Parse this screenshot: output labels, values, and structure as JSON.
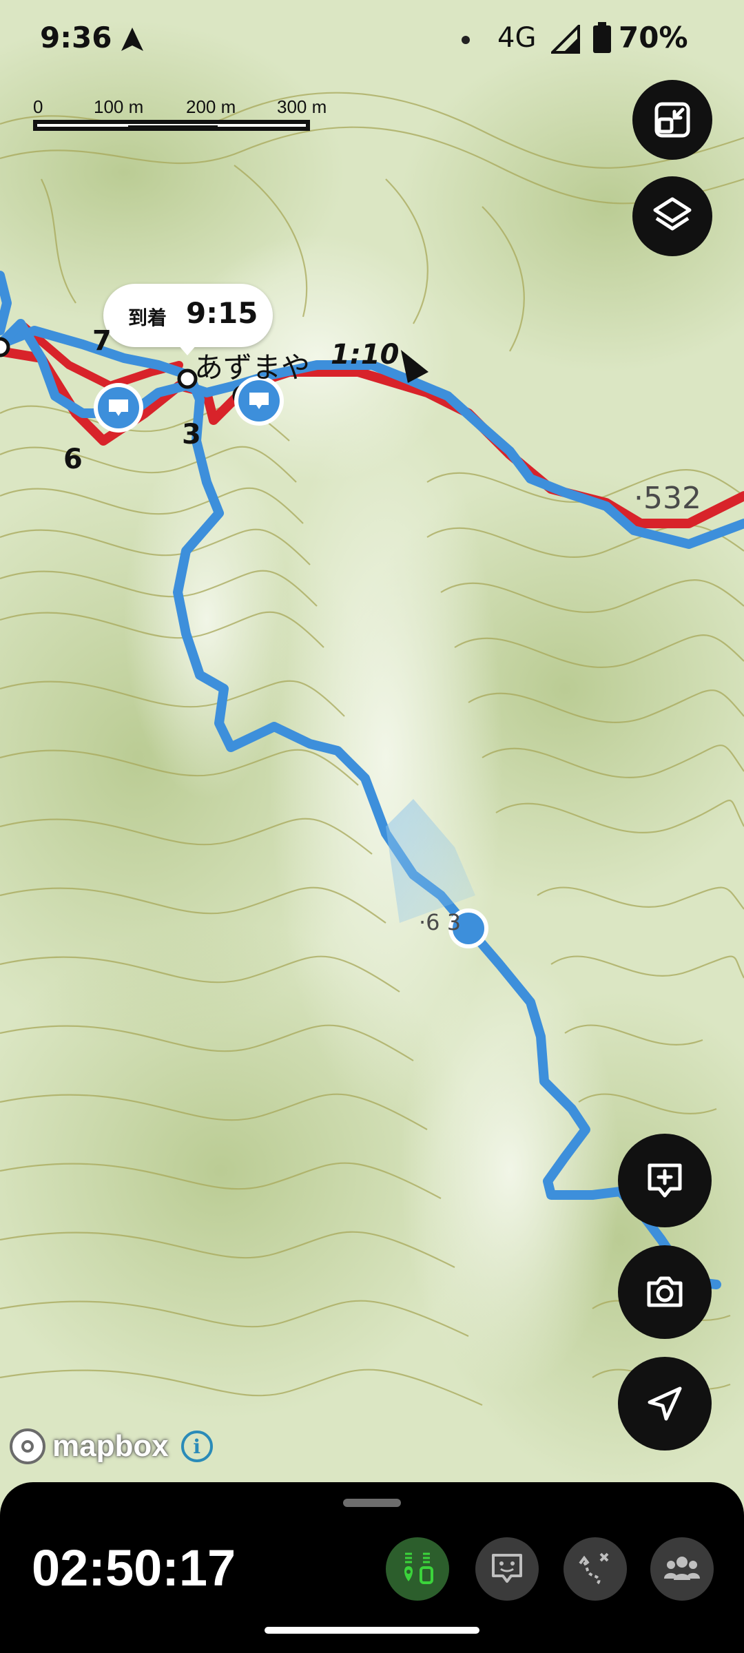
{
  "status_bar": {
    "time": "9:36",
    "network": "4G",
    "battery": "70%"
  },
  "scale_bar": {
    "labels": [
      "0",
      "100 m",
      "200 m",
      "300 m"
    ]
  },
  "map": {
    "arrival_bubble": {
      "label": "到着",
      "time": "9:15"
    },
    "place_name": "あずまや",
    "segment_time": "1:10",
    "waypoint_numbers": [
      "7",
      "6",
      "3"
    ],
    "elevation_labels": [
      "532",
      "6  3"
    ],
    "attribution": "mapbox",
    "info_glyph": "i"
  },
  "fab_buttons": {
    "top": [
      "fullscreen-exit-icon",
      "layers-icon"
    ],
    "bottom": [
      "add-comment-icon",
      "camera-icon",
      "navigation-icon"
    ]
  },
  "bottom_sheet": {
    "elapsed_time": "02:50:17",
    "controls": [
      "recording-status-icon",
      "memo-icon",
      "route-icon",
      "group-icon"
    ]
  },
  "colors": {
    "track_blue": "#3d8fdb",
    "route_red": "#d8232a",
    "active_green": "#3bd43b",
    "sheet_bg": "#000000"
  }
}
